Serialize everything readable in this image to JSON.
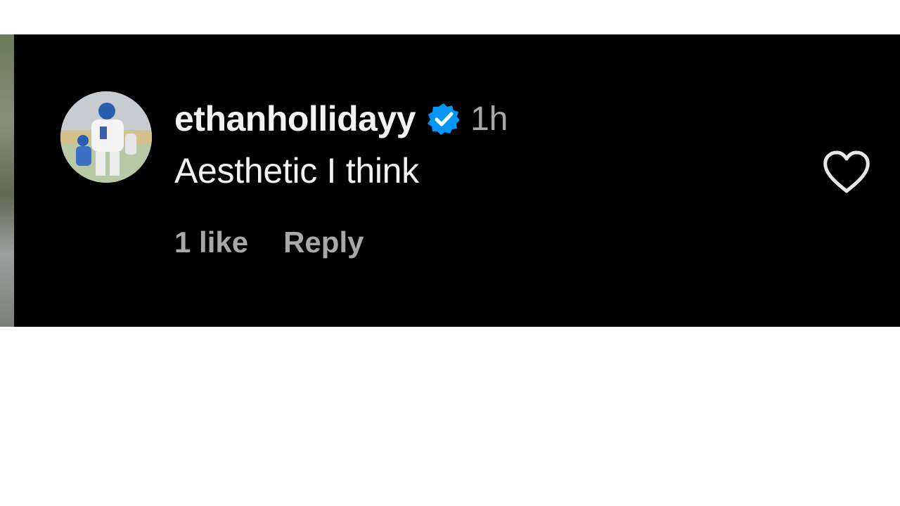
{
  "comment": {
    "username": "ethanhollidayy",
    "verified_icon": "verified-badge-icon",
    "time": "1h",
    "text": "Aesthetic I think",
    "likes": "1 like",
    "reply_label": "Reply",
    "like_icon": "heart-outline-icon"
  },
  "colors": {
    "background": "#000000",
    "primary_text": "#f2f2f2",
    "secondary_text": "#a8a8a8",
    "verified": "#0095f6"
  }
}
